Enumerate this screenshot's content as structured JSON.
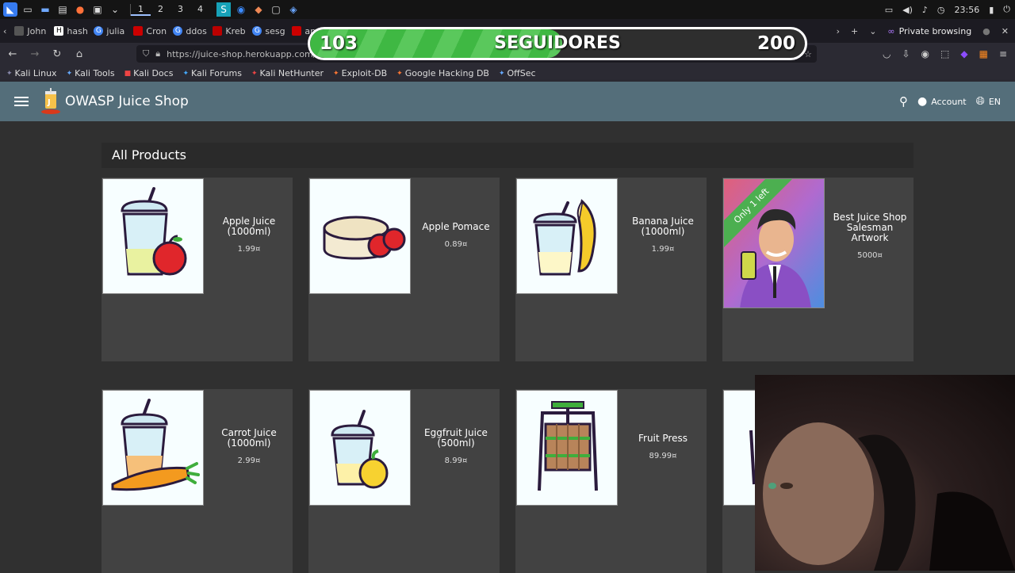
{
  "taskbar": {
    "workspaces": [
      "1",
      "2",
      "3",
      "4"
    ],
    "clock": "23:56"
  },
  "tabs": [
    {
      "label": "John",
      "color": "#555"
    },
    {
      "label": "hash",
      "color": "#333"
    },
    {
      "label": "julia",
      "color": "#4285f4"
    },
    {
      "label": "Cron",
      "color": "#cc0000"
    },
    {
      "label": "ddos",
      "color": "#4285f4"
    },
    {
      "label": "Kreb",
      "color": "#b00"
    },
    {
      "label": "sesg",
      "color": "#4285f4"
    },
    {
      "label": "an",
      "color": "#c00"
    }
  ],
  "browser": {
    "private_label": "Private browsing",
    "url": "https://juice-shop.herokuapp.com/#/"
  },
  "bookmarks": [
    "Kali Linux",
    "Kali Tools",
    "Kali Docs",
    "Kali Forums",
    "Kali NetHunter",
    "Exploit-DB",
    "Google Hacking DB",
    "OffSec"
  ],
  "overlay": {
    "current": "103",
    "label": "SEGUIDORES",
    "goal": "200",
    "progress": 0.51
  },
  "app": {
    "title": "OWASP Juice Shop",
    "account_label": "Account",
    "language": "EN",
    "section_title": "All Products"
  },
  "products": [
    {
      "name": "Apple Juice (1000ml)",
      "price": "1.99¤"
    },
    {
      "name": "Apple Pomace",
      "price": "0.89¤"
    },
    {
      "name": "Banana Juice (1000ml)",
      "price": "1.99¤"
    },
    {
      "name": "Best Juice Shop Salesman Artwork",
      "price": "5000¤",
      "ribbon": "Only 1 left"
    },
    {
      "name": "Carrot Juice (1000ml)",
      "price": "2.99¤"
    },
    {
      "name": "Eggfruit Juice (500ml)",
      "price": "8.99¤"
    },
    {
      "name": "Fruit Press",
      "price": "89.99¤"
    },
    {
      "name": "",
      "price": ""
    }
  ]
}
